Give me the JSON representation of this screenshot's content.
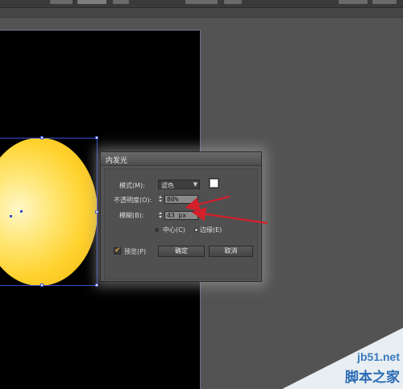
{
  "dialog": {
    "title": "内发光",
    "mode_label": "模式(M):",
    "mode_value": "滤色",
    "opacity_label": "不透明度(O):",
    "opacity_value": "80%",
    "blur_label": "模糊(B):",
    "blur_value": "43 px",
    "center_label": "中心(C)",
    "edge_label": "边缘(E)",
    "selected_source": "边缘(E)",
    "preview_label": "预览(P)",
    "preview_checked": true,
    "ok_label": "确定",
    "cancel_label": "取消",
    "glow_color": "#ffffff"
  },
  "artwork": {
    "fill_colors": [
      "#fff7c8",
      "#ffd22e",
      "#f2b410"
    ],
    "selection_color": "#3a4fd0"
  },
  "annotation_color": "#d4202a",
  "watermark": {
    "domain": "jb51.net",
    "name": "脚本之家"
  }
}
